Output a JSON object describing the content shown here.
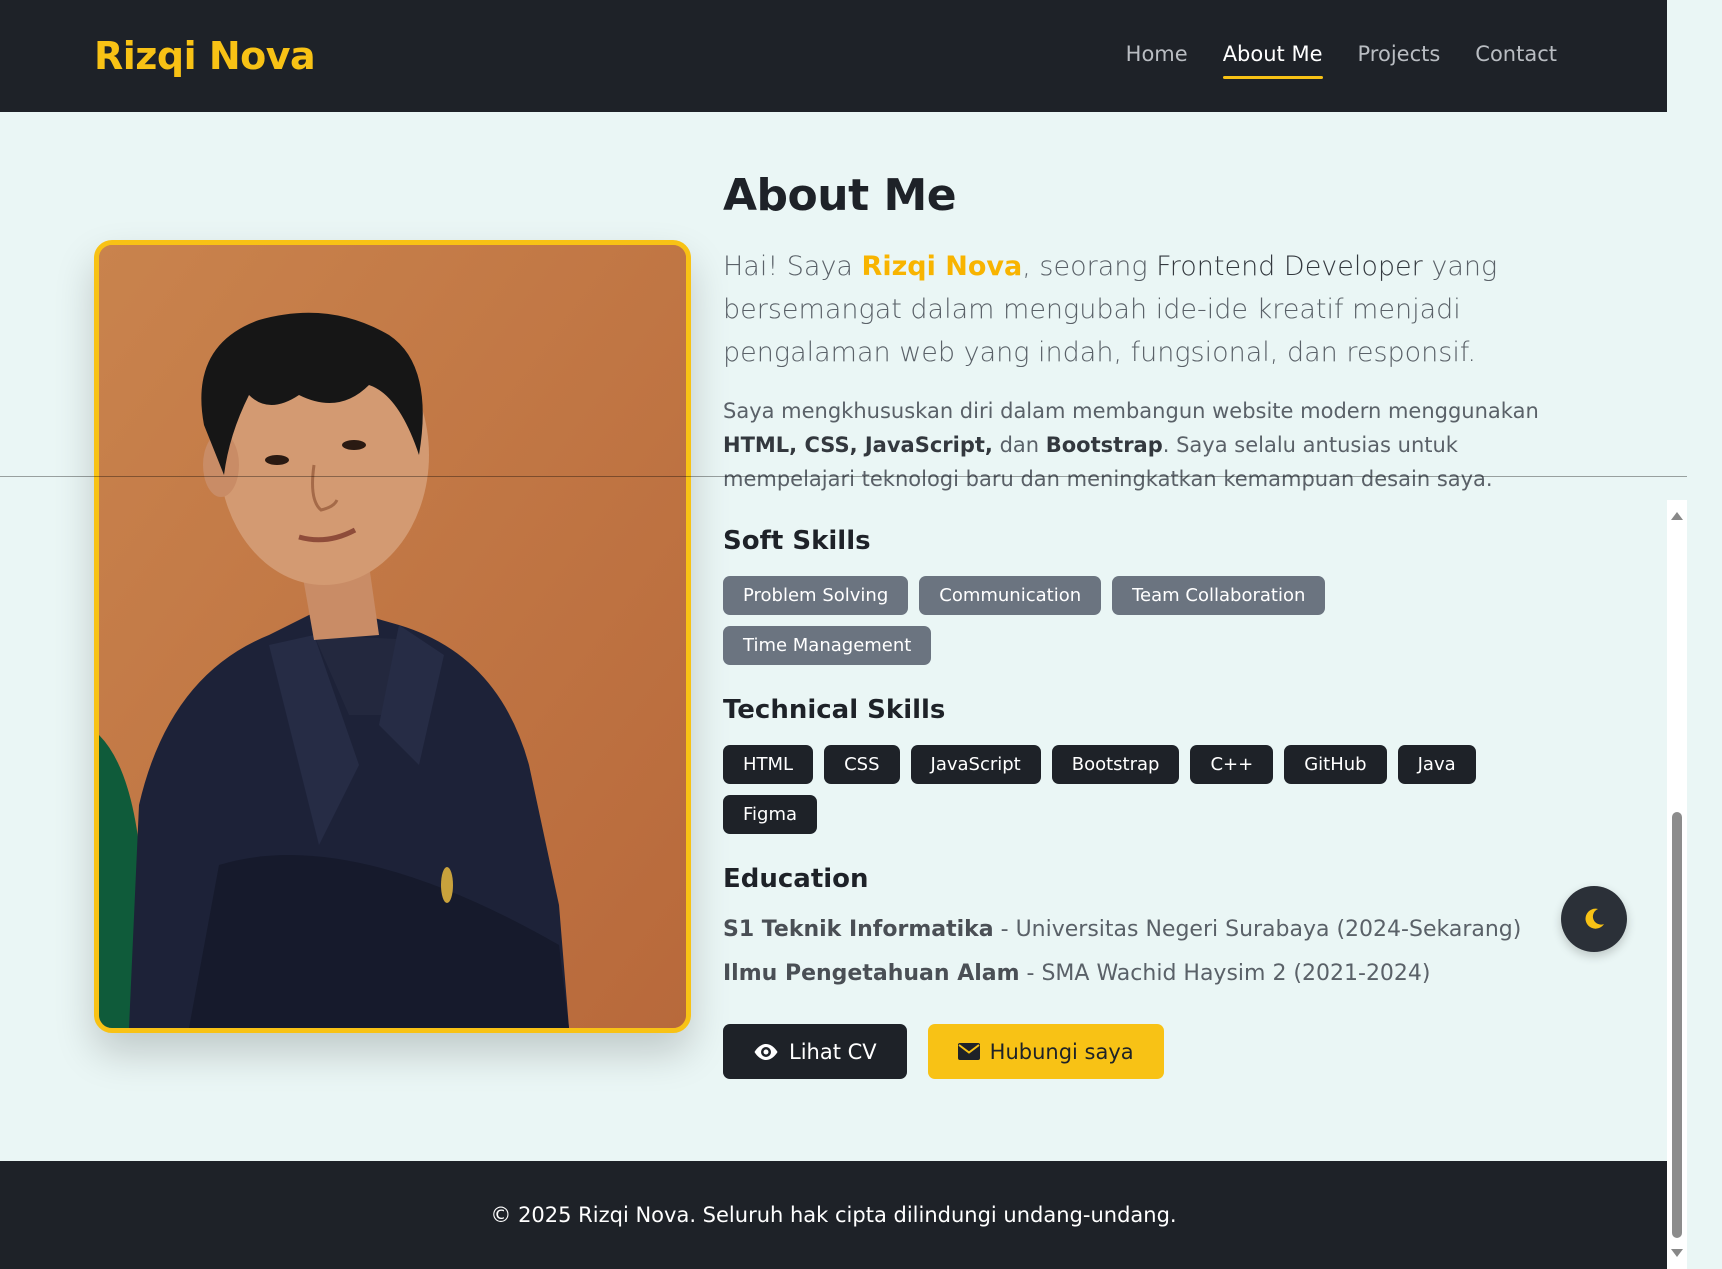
{
  "brand": "Rizqi Nova",
  "nav": {
    "home": "Home",
    "about": "About Me",
    "projects": "Projects",
    "contact": "Contact"
  },
  "about": {
    "heading": "About Me",
    "lead_prefix": "Hai! Saya ",
    "lead_name": "Rizqi Nova",
    "lead_mid": ", seorang ",
    "lead_role": "Frontend Developer",
    "lead_suffix": " yang bersemangat dalam mengubah ide-ide kreatif menjadi pengalaman web yang indah, fungsional, dan responsif.",
    "para_prefix": "Saya mengkhususkan diri dalam membangun website modern menggunakan ",
    "para_tech": "HTML, CSS, JavaScript,",
    "para_mid": " dan ",
    "para_bootstrap": "Bootstrap",
    "para_suffix": ". Saya selalu antusias untuk mempelajari teknologi baru dan meningkatkan kemampuan desain saya."
  },
  "soft_skills": {
    "title": "Soft Skills",
    "items": [
      "Problem Solving",
      "Communication",
      "Team Collaboration",
      "Time Management"
    ]
  },
  "technical_skills": {
    "title": "Technical Skills",
    "items": [
      "HTML",
      "CSS",
      "JavaScript",
      "Bootstrap",
      "C++",
      "GitHub",
      "Java",
      "Figma"
    ]
  },
  "education": {
    "title": "Education",
    "items": [
      {
        "degree": "S1 Teknik Informatika",
        "detail": " - Universitas Negeri Surabaya (2024-Sekarang)"
      },
      {
        "degree": "Ilmu Pengetahuan Alam",
        "detail": " - SMA Wachid Haysim 2 (2021-2024)"
      }
    ]
  },
  "buttons": {
    "cv": "Lihat CV",
    "contact": "Hubungi saya"
  },
  "footer": "© 2025 Rizqi Nova. Seluruh hak cipta dilindungi undang-undang.",
  "icons": {
    "cv": "eye-icon",
    "contact": "envelope-icon",
    "theme": "moon-icon"
  },
  "colors": {
    "accent": "#f8c215",
    "dark": "#1e2228",
    "background": "#eaf6f5",
    "soft_badge": "#6b7480"
  }
}
